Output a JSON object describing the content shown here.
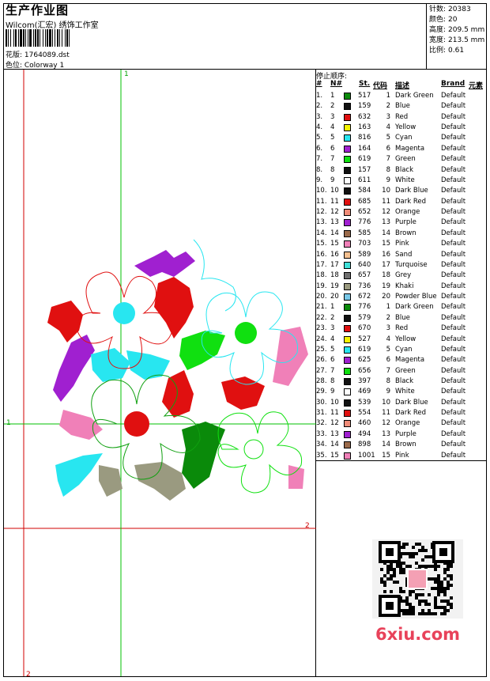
{
  "header": {
    "title": "生产作业图",
    "subtitle": "Wilcom(汇宏) 绣饰工作室",
    "design": "花版:  1764089.dst",
    "colorway": "色位:  Colorway 1"
  },
  "stats": [
    {
      "label": "针数:",
      "value": "20383"
    },
    {
      "label": "颜色:",
      "value": "20"
    },
    {
      "label": "高度:",
      "value": "209.5 mm"
    },
    {
      "label": "宽度:",
      "value": "213.5 mm"
    },
    {
      "label": "比例:",
      "value": "0.61"
    }
  ],
  "axis": {
    "green_top": "1",
    "green_left": "1",
    "red_right": "2",
    "red_bottom": "2"
  },
  "stop_sequence": {
    "title": "停止顺序:",
    "headers": [
      "#",
      "N#",
      "St.",
      "代码",
      "描述",
      "Brand",
      "元素"
    ],
    "rows": [
      {
        "idx": "1.",
        "n": "1",
        "color": "#0a8a0a",
        "st": "517",
        "code": "1",
        "desc": "Dark Green",
        "brand": "Default"
      },
      {
        "idx": "2.",
        "n": "2",
        "color": "#111111",
        "st": "159",
        "code": "2",
        "desc": "Blue",
        "brand": "Default"
      },
      {
        "idx": "3.",
        "n": "3",
        "color": "#e01010",
        "st": "632",
        "code": "3",
        "desc": "Red",
        "brand": "Default"
      },
      {
        "idx": "4.",
        "n": "4",
        "color": "#f5f500",
        "st": "163",
        "code": "4",
        "desc": "Yellow",
        "brand": "Default"
      },
      {
        "idx": "5.",
        "n": "5",
        "color": "#28e6f0",
        "st": "816",
        "code": "5",
        "desc": "Cyan",
        "brand": "Default"
      },
      {
        "idx": "6.",
        "n": "6",
        "color": "#a020d0",
        "st": "164",
        "code": "6",
        "desc": "Magenta",
        "brand": "Default"
      },
      {
        "idx": "7.",
        "n": "7",
        "color": "#10e010",
        "st": "619",
        "code": "7",
        "desc": "Green",
        "brand": "Default"
      },
      {
        "idx": "8.",
        "n": "8",
        "color": "#111111",
        "st": "157",
        "code": "8",
        "desc": "Black",
        "brand": "Default"
      },
      {
        "idx": "9.",
        "n": "9",
        "color": "#ffffff",
        "st": "611",
        "code": "9",
        "desc": "White",
        "brand": "Default"
      },
      {
        "idx": "10.",
        "n": "10",
        "color": "#111111",
        "st": "584",
        "code": "10",
        "desc": "Dark Blue",
        "brand": "Default"
      },
      {
        "idx": "11.",
        "n": "11",
        "color": "#e01010",
        "st": "685",
        "code": "11",
        "desc": "Dark Red",
        "brand": "Default"
      },
      {
        "idx": "12.",
        "n": "12",
        "color": "#f08c78",
        "st": "652",
        "code": "12",
        "desc": "Orange",
        "brand": "Default"
      },
      {
        "idx": "13.",
        "n": "13",
        "color": "#a020d0",
        "st": "776",
        "code": "13",
        "desc": "Purple",
        "brand": "Default"
      },
      {
        "idx": "14.",
        "n": "14",
        "color": "#9a6a4a",
        "st": "585",
        "code": "14",
        "desc": "Brown",
        "brand": "Default"
      },
      {
        "idx": "15.",
        "n": "15",
        "color": "#f080b8",
        "st": "703",
        "code": "15",
        "desc": "Pink",
        "brand": "Default"
      },
      {
        "idx": "16.",
        "n": "16",
        "color": "#f4c090",
        "st": "589",
        "code": "16",
        "desc": "Sand",
        "brand": "Default"
      },
      {
        "idx": "17.",
        "n": "17",
        "color": "#40e0d8",
        "st": "640",
        "code": "17",
        "desc": "Turquoise",
        "brand": "Default"
      },
      {
        "idx": "18.",
        "n": "18",
        "color": "#707070",
        "st": "657",
        "code": "18",
        "desc": "Grey",
        "brand": "Default"
      },
      {
        "idx": "19.",
        "n": "19",
        "color": "#9a9a80",
        "st": "736",
        "code": "19",
        "desc": "Khaki",
        "brand": "Default"
      },
      {
        "idx": "20.",
        "n": "20",
        "color": "#78c8e8",
        "st": "672",
        "code": "20",
        "desc": "Powder Blue",
        "brand": "Default"
      },
      {
        "idx": "21.",
        "n": "1",
        "color": "#0a8a0a",
        "st": "776",
        "code": "1",
        "desc": "Dark Green",
        "brand": "Default"
      },
      {
        "idx": "22.",
        "n": "2",
        "color": "#111111",
        "st": "579",
        "code": "2",
        "desc": "Blue",
        "brand": "Default"
      },
      {
        "idx": "23.",
        "n": "3",
        "color": "#e01010",
        "st": "670",
        "code": "3",
        "desc": "Red",
        "brand": "Default"
      },
      {
        "idx": "24.",
        "n": "4",
        "color": "#f5f500",
        "st": "527",
        "code": "4",
        "desc": "Yellow",
        "brand": "Default"
      },
      {
        "idx": "25.",
        "n": "5",
        "color": "#28e6f0",
        "st": "619",
        "code": "5",
        "desc": "Cyan",
        "brand": "Default"
      },
      {
        "idx": "26.",
        "n": "6",
        "color": "#a020d0",
        "st": "625",
        "code": "6",
        "desc": "Magenta",
        "brand": "Default"
      },
      {
        "idx": "27.",
        "n": "7",
        "color": "#10e010",
        "st": "656",
        "code": "7",
        "desc": "Green",
        "brand": "Default"
      },
      {
        "idx": "28.",
        "n": "8",
        "color": "#111111",
        "st": "397",
        "code": "8",
        "desc": "Black",
        "brand": "Default"
      },
      {
        "idx": "29.",
        "n": "9",
        "color": "#ffffff",
        "st": "469",
        "code": "9",
        "desc": "White",
        "brand": "Default"
      },
      {
        "idx": "30.",
        "n": "10",
        "color": "#111111",
        "st": "539",
        "code": "10",
        "desc": "Dark Blue",
        "brand": "Default"
      },
      {
        "idx": "31.",
        "n": "11",
        "color": "#e01010",
        "st": "554",
        "code": "11",
        "desc": "Dark Red",
        "brand": "Default"
      },
      {
        "idx": "32.",
        "n": "12",
        "color": "#f08c78",
        "st": "460",
        "code": "12",
        "desc": "Orange",
        "brand": "Default"
      },
      {
        "idx": "33.",
        "n": "13",
        "color": "#a020d0",
        "st": "494",
        "code": "13",
        "desc": "Purple",
        "brand": "Default"
      },
      {
        "idx": "34.",
        "n": "14",
        "color": "#9a6a4a",
        "st": "898",
        "code": "14",
        "desc": "Brown",
        "brand": "Default"
      },
      {
        "idx": "35.",
        "n": "15",
        "color": "#f080b8",
        "st": "1001",
        "code": "15",
        "desc": "Pink",
        "brand": "Default"
      }
    ]
  },
  "watermark": {
    "logo": "6xiu.com"
  },
  "colors": {
    "guide_green": "#00c000",
    "guide_red": "#d00000",
    "logo": "#e8425a"
  }
}
